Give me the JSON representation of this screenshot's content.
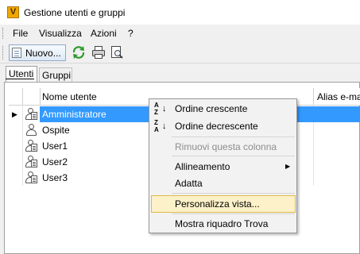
{
  "window": {
    "title": "Gestione utenti e gruppi",
    "app_icon_glyph": "V"
  },
  "menu": [
    {
      "label": "File"
    },
    {
      "label": "Visualizza"
    },
    {
      "label": "Azioni"
    },
    {
      "label": "?"
    }
  ],
  "toolbar": {
    "new_label": "Nuovo...",
    "icons": [
      "refresh-icon",
      "print-icon",
      "print-preview-icon"
    ]
  },
  "tabs": [
    {
      "label": "Utenti",
      "active": true
    },
    {
      "label": "Gruppi",
      "active": false
    }
  ],
  "grid": {
    "columns": [
      "Nome utente",
      "Alias e-ma"
    ],
    "rows": [
      {
        "name": "Amministratore",
        "selected": true,
        "icon": "user-admin-icon"
      },
      {
        "name": "Ospite",
        "selected": false,
        "icon": "user-icon"
      },
      {
        "name": "User1",
        "selected": false,
        "icon": "user-admin-icon"
      },
      {
        "name": "User2",
        "selected": false,
        "icon": "user-admin-icon"
      },
      {
        "name": "User3",
        "selected": false,
        "icon": "user-admin-icon"
      }
    ]
  },
  "context_menu": {
    "items": [
      {
        "label": "Ordine crescente",
        "icon": "sort-ascending-icon",
        "icon_text": "A Z",
        "enabled": true
      },
      {
        "label": "Ordine decrescente",
        "icon": "sort-descending-icon",
        "icon_text": "Z A",
        "enabled": true
      },
      {
        "label": "Rimuovi questa colonna",
        "enabled": false
      },
      {
        "label": "Allineamento",
        "has_submenu": true,
        "enabled": true
      },
      {
        "label": "Adatta",
        "enabled": true
      },
      {
        "label": "Personalizza vista...",
        "highlighted": true,
        "enabled": true
      },
      {
        "label": "Mostra riquadro Trova",
        "enabled": true
      }
    ]
  },
  "colors": {
    "selection": "#3399ff",
    "menu_highlight_bg": "#fcf1c8",
    "menu_highlight_border": "#e0b84a",
    "app_icon": "#f0a800"
  }
}
